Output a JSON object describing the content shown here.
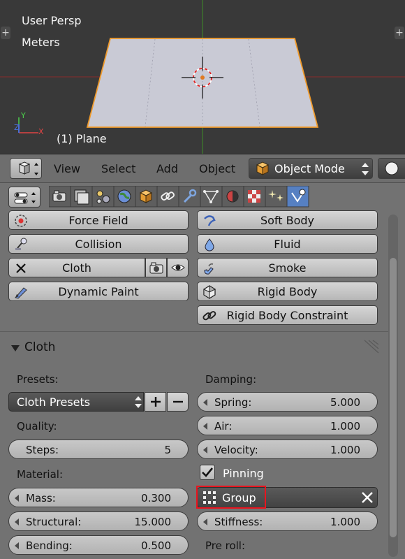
{
  "viewport": {
    "view_name": "User Persp",
    "units": "Meters",
    "object_label": "(1) Plane"
  },
  "header": {
    "menus": [
      "View",
      "Select",
      "Add",
      "Object"
    ],
    "mode": "Object Mode"
  },
  "context_tabs": [
    "render",
    "render-layers",
    "scene",
    "world",
    "object",
    "constraints",
    "modifiers",
    "data",
    "material",
    "texture",
    "particles",
    "physics"
  ],
  "physics": {
    "buttons": {
      "force_field": "Force Field",
      "collision": "Collision",
      "cloth": "Cloth",
      "dynamic_paint": "Dynamic Paint",
      "soft_body": "Soft Body",
      "fluid": "Fluid",
      "smoke": "Smoke",
      "rigid_body": "Rigid Body",
      "rigid_body_constraint": "Rigid Body Constraint"
    }
  },
  "cloth_panel": {
    "title": "Cloth",
    "presets_label": "Presets:",
    "presets_value": "Cloth Presets",
    "quality_label": "Quality:",
    "steps": {
      "label": "Steps:",
      "value": "5"
    },
    "material_label": "Material:",
    "mass": {
      "label": "Mass:",
      "value": "0.300"
    },
    "structural": {
      "label": "Structural:",
      "value": "15.000"
    },
    "bending": {
      "label": "Bending:",
      "value": "0.500"
    },
    "damping_label": "Damping:",
    "spring": {
      "label": "Spring:",
      "value": "5.000"
    },
    "air": {
      "label": "Air:",
      "value": "1.000"
    },
    "velocity": {
      "label": "Velocity:",
      "value": "1.000"
    },
    "pinning": {
      "label": "Pinning",
      "checked": true
    },
    "group": {
      "label": "Group"
    },
    "stiffness": {
      "label": "Stiffness:",
      "value": "1.000"
    },
    "preroll_label": "Pre roll:"
  },
  "colors": {
    "highlight_box": "#e8141e",
    "active_tab": "#5680c2",
    "selection_outline": "#f0a030"
  }
}
